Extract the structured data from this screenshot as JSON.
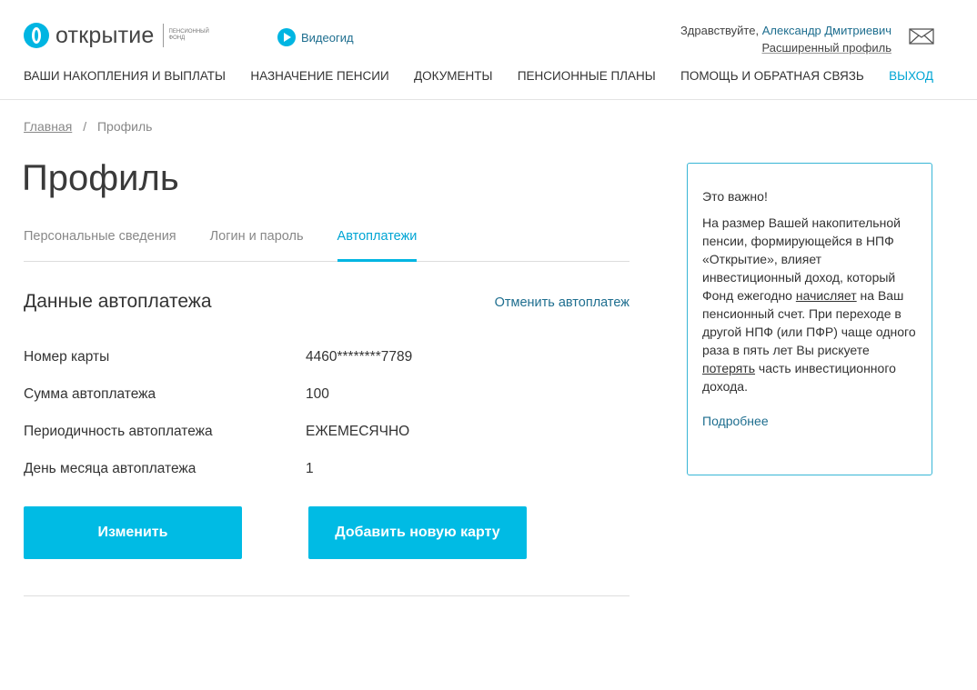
{
  "header": {
    "logo_text": "открытие",
    "logo_sub": "пенсионный фонд",
    "video_label": "Видеогид",
    "greeting": "Здравствуйте,",
    "user_name": "Александр Дмитриевич",
    "extended_profile": "Расширенный профиль"
  },
  "nav": {
    "items": [
      "ВАШИ НАКОПЛЕНИЯ И ВЫПЛАТЫ",
      "НАЗНАЧЕНИЕ ПЕНСИИ",
      "ДОКУМЕНТЫ",
      "ПЕНСИОННЫЕ ПЛАНЫ",
      "ПОМОЩЬ И ОБРАТНАЯ СВЯЗЬ"
    ],
    "logout": "ВЫХОД"
  },
  "breadcrumb": {
    "home": "Главная",
    "separator": "/",
    "current": "Профиль"
  },
  "page": {
    "title": "Профиль",
    "tabs": [
      "Персональные сведения",
      "Логин и пароль",
      "Автоплатежи"
    ],
    "active_tab": 2
  },
  "autopay": {
    "section_title": "Данные автоплатежа",
    "cancel_link": "Отменить автоплатеж",
    "rows": [
      {
        "label": "Номер карты",
        "value": "4460********7789"
      },
      {
        "label": "Сумма автоплатежа",
        "value": "100"
      },
      {
        "label": "Периодичность автоплатежа",
        "value": "ЕЖЕМЕСЯЧНО"
      },
      {
        "label": "День месяца автоплатежа",
        "value": "1"
      }
    ],
    "edit_button": "Изменить",
    "add_card_button": "Добавить новую карту"
  },
  "notice": {
    "title": "Это важно!",
    "text_1": "На размер Вашей накопительной пенсии, формирующейся в НПФ «Открытие», влияет инвестиционный доход, который Фонд ежегодно ",
    "text_u1": "начисляет",
    "text_2": " на Ваш пенсионный счет. При переходе в другой НПФ (или ПФР) чаще одного раза в пять лет Вы рискуете ",
    "text_u2": "потерять",
    "text_3": " часть инвестиционного дохода.",
    "more_link": "Подробнее"
  },
  "colors": {
    "accent": "#00b5e2",
    "link": "#1e6e8f",
    "border": "#38b6d6"
  },
  "icons": [
    "logo-mark-icon",
    "play-icon",
    "mail-icon"
  ]
}
